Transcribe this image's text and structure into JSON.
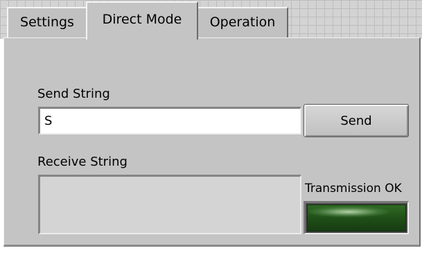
{
  "tabs": [
    {
      "label": "Settings",
      "active": false
    },
    {
      "label": "Direct Mode",
      "active": true
    },
    {
      "label": "Operation",
      "active": false
    }
  ],
  "direct_mode": {
    "send_label": "Send String",
    "send_value": "S",
    "send_button": "Send",
    "receive_label": "Receive String",
    "receive_value": "",
    "led_label": "Transmission OK",
    "led_on_color": "#2f6a24",
    "led_state": "on"
  },
  "colors": {
    "panel": "#c4c4c4",
    "input_bg": "#ffffff",
    "receive_bg": "#d4d4d4"
  }
}
